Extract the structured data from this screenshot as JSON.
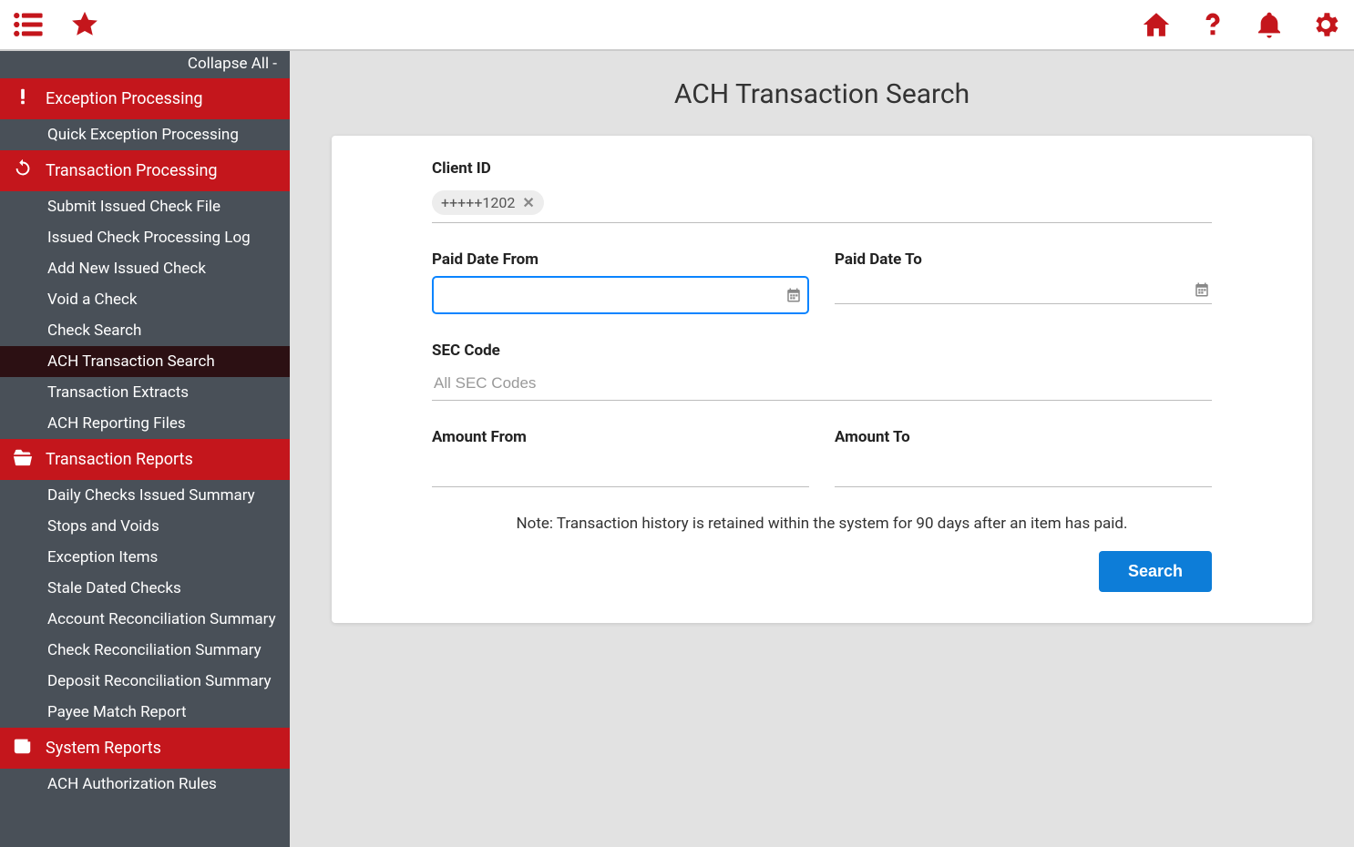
{
  "topbar": {},
  "sidebar": {
    "collapse_label": "Collapse All -",
    "sections": [
      {
        "icon": "alert",
        "label": "Exception Processing",
        "items": [
          {
            "label": "Quick Exception Processing",
            "active": false
          }
        ]
      },
      {
        "icon": "refresh",
        "label": "Transaction Processing",
        "items": [
          {
            "label": "Submit Issued Check File",
            "active": false
          },
          {
            "label": "Issued Check Processing Log",
            "active": false
          },
          {
            "label": "Add New Issued Check",
            "active": false
          },
          {
            "label": "Void a Check",
            "active": false
          },
          {
            "label": "Check Search",
            "active": false
          },
          {
            "label": "ACH Transaction Search",
            "active": true
          },
          {
            "label": "Transaction Extracts",
            "active": false
          },
          {
            "label": "ACH Reporting Files",
            "active": false
          }
        ]
      },
      {
        "icon": "folder",
        "label": "Transaction Reports",
        "items": [
          {
            "label": "Daily Checks Issued Summary",
            "active": false
          },
          {
            "label": "Stops and Voids",
            "active": false
          },
          {
            "label": "Exception Items",
            "active": false
          },
          {
            "label": "Stale Dated Checks",
            "active": false
          },
          {
            "label": "Account Reconciliation Summary",
            "active": false
          },
          {
            "label": "Check Reconciliation Summary",
            "active": false
          },
          {
            "label": "Deposit Reconciliation Summary",
            "active": false
          },
          {
            "label": "Payee Match Report",
            "active": false
          }
        ]
      },
      {
        "icon": "news",
        "label": "System Reports",
        "items": [
          {
            "label": "ACH Authorization Rules",
            "active": false
          }
        ]
      }
    ]
  },
  "page": {
    "title": "ACH Transaction Search",
    "client_id": {
      "label": "Client ID",
      "chip": "+++++1202"
    },
    "paid_date_from": {
      "label": "Paid Date From",
      "value": ""
    },
    "paid_date_to": {
      "label": "Paid Date To",
      "value": ""
    },
    "sec_code": {
      "label": "SEC Code",
      "placeholder": "All SEC Codes"
    },
    "amount_from": {
      "label": "Amount From",
      "value": ""
    },
    "amount_to": {
      "label": "Amount To",
      "value": ""
    },
    "note": "Note: Transaction history is retained within the system for 90 days after an item has paid.",
    "search_btn": "Search"
  }
}
